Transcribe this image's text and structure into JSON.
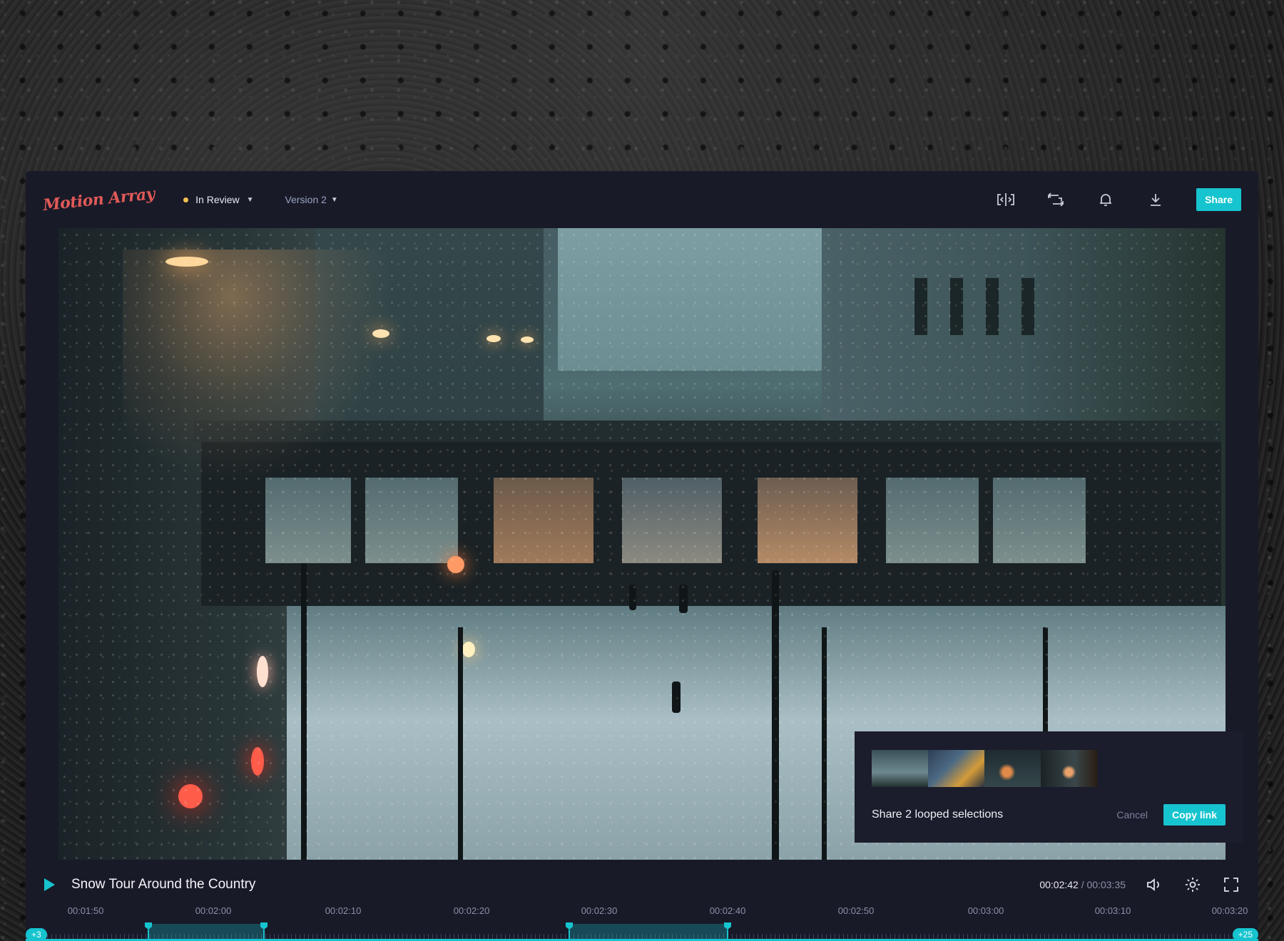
{
  "app": {
    "logo_text": "Motion Array",
    "status_label": "In Review",
    "version_label": "Version 2",
    "share_label": "Share",
    "icons": [
      "compare-icon",
      "loop-icon",
      "bell-icon",
      "download-icon"
    ]
  },
  "share_panel": {
    "message": "Share 2 looped selections",
    "cancel_label": "Cancel",
    "copy_label": "Copy link"
  },
  "player": {
    "title": "Snow Tour Around the Country",
    "current_time": "00:02:42",
    "separator": "/",
    "total_time": "00:03:35",
    "icons": [
      "play-icon",
      "volume-icon",
      "settings-icon",
      "fullscreen-icon"
    ]
  },
  "timeline": {
    "ticks": [
      "00:01:50",
      "00:02:00",
      "00:02:10",
      "00:02:20",
      "00:02:30",
      "00:02:40",
      "00:02:50",
      "00:03:00",
      "00:03:10",
      "00:03:20"
    ],
    "left_badge": "+3",
    "right_badge": "+25",
    "selections": [
      {
        "start": "00:02:00",
        "end": "00:02:09"
      },
      {
        "start": "00:02:30",
        "end": "00:02:42"
      }
    ]
  },
  "colors": {
    "accent": "#16c4cf",
    "status_dot": "#f2c14e",
    "logo": "#e05a57",
    "panel": "#191a28"
  }
}
